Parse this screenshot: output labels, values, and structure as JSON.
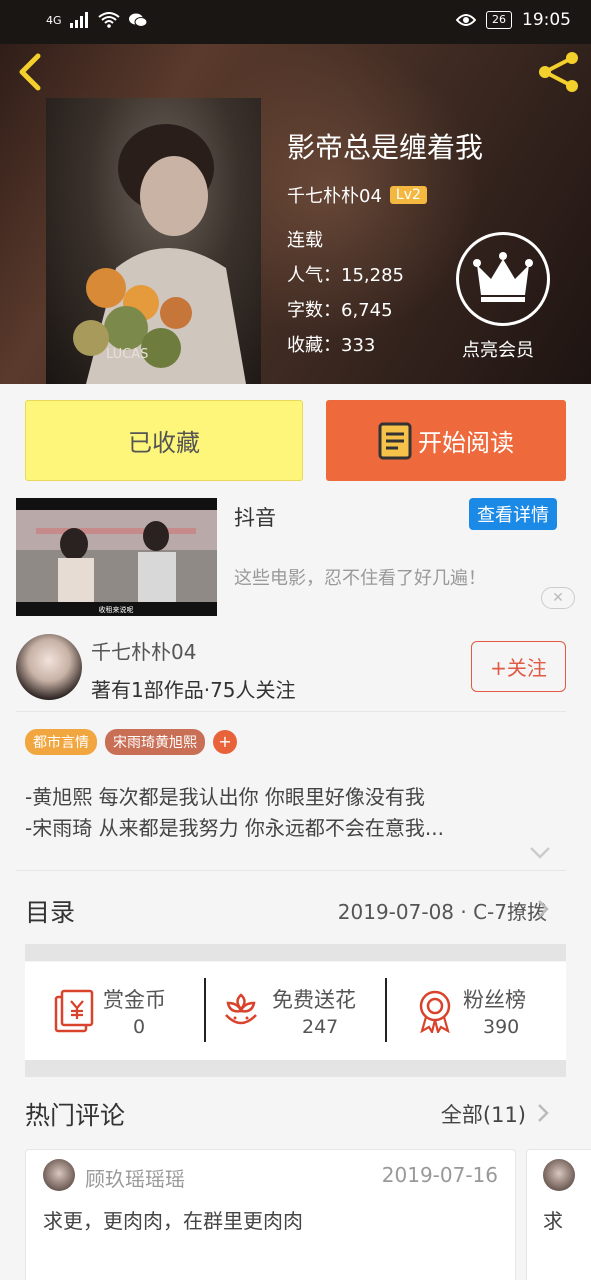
{
  "status_bar": {
    "network": "4G",
    "battery": "26",
    "time": "19:05"
  },
  "book": {
    "title": "影帝总是缠着我",
    "author": "千七朴朴04",
    "level": "Lv2",
    "status": "连载",
    "popularity": "人气：15,285",
    "words": "字数：6,745",
    "favorites": "收藏：333",
    "vip_label": "点亮会员",
    "cover_text": "LUCAS"
  },
  "actions": {
    "collected": "已收藏",
    "read": "开始阅读"
  },
  "ad": {
    "title": "抖音",
    "detail_button": "查看详情",
    "description": "这些电影，忍不住看了好几遍！",
    "thumb_caption": "收租来说呢",
    "close": "✕"
  },
  "author": {
    "name": "千七朴朴04",
    "info": "著有1部作品·75人关注",
    "follow": "+关注"
  },
  "tags": [
    {
      "label": "都市言情",
      "color": "#f2a640"
    },
    {
      "label": "宋雨琦黄旭熙",
      "color": "#c96f56"
    }
  ],
  "tag_add": "+",
  "intro": [
    "-黄旭熙 每次都是我认出你 你眼里好像没有我",
    "-宋雨琦 从来都是我努力 你永远都不会在意我..."
  ],
  "catalog": {
    "title": "目录",
    "latest": "2019-07-08 · C-7撩拨"
  },
  "stats": [
    {
      "label": "赏金币",
      "value": "0",
      "icon": "red-envelope-yuan-icon"
    },
    {
      "label": "免费送花",
      "value": "247",
      "icon": "flower-icon"
    },
    {
      "label": "粉丝榜",
      "value": "390",
      "icon": "medal-icon"
    }
  ],
  "comments": {
    "title": "热门评论",
    "all": "全部(11)",
    "items": [
      {
        "user": "顾玖瑶瑶瑶",
        "date": "2019-07-16",
        "text": "求更，更肉肉，在群里更肉肉"
      },
      {
        "text": "求"
      }
    ]
  },
  "colors": {
    "accent_orange": "#ee6a3c",
    "collected_yellow": "#fdf67a",
    "link_blue": "#1a8ae6",
    "icon_red": "#d9432c",
    "gold": "#f4d02c"
  }
}
